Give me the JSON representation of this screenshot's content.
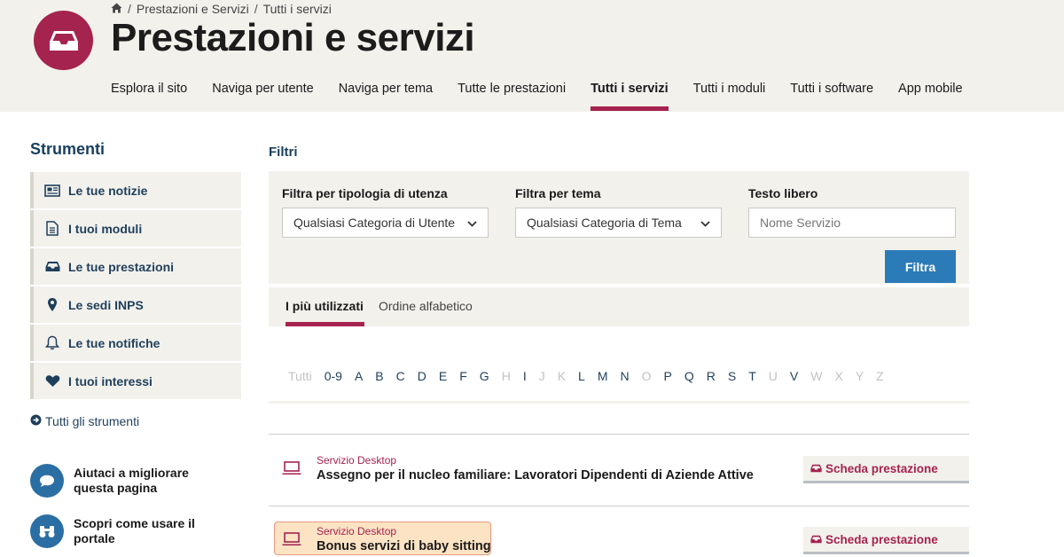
{
  "header": {
    "breadcrumb": [
      "Prestazioni e Servizi",
      "Tutti i servizi"
    ],
    "breadcrumb_sep": "/",
    "title": "Prestazioni e servizi",
    "nav": [
      "Esplora il sito",
      "Naviga per utente",
      "Naviga per tema",
      "Tutte le prestazioni",
      "Tutti i servizi",
      "Tutti i moduli",
      "Tutti i software",
      "App mobile"
    ],
    "nav_active": "Tutti i servizi"
  },
  "sidebar": {
    "title": "Strumenti",
    "items": [
      {
        "label": "Le tue notizie",
        "icon": "newspaper-icon"
      },
      {
        "label": "I tuoi moduli",
        "icon": "document-icon"
      },
      {
        "label": "Le tue prestazioni",
        "icon": "inbox-icon"
      },
      {
        "label": "Le sedi INPS",
        "icon": "map-pin-icon"
      },
      {
        "label": "Le tue notifiche",
        "icon": "bell-icon"
      },
      {
        "label": "I tuoi interessi",
        "icon": "heart-icon"
      }
    ],
    "all_tools": "Tutti gli strumenti",
    "help": [
      {
        "label": "Aiutaci a migliorare questa pagina",
        "icon": "chat-bubble-icon"
      },
      {
        "label": "Scopri come usare il portale",
        "icon": "binoculars-icon"
      }
    ]
  },
  "filters": {
    "heading": "Filtri",
    "user_type_label": "Filtra per tipologia di utenza",
    "user_type_value": "Qualsiasi Categoria di Utente",
    "theme_label": "Filtra per tema",
    "theme_value": "Qualsiasi Categoria di Tema",
    "text_label": "Testo libero",
    "text_placeholder": "Nome Servizio",
    "submit": "Filtra"
  },
  "tabs": {
    "items": [
      "I più utilizzati",
      "Ordine alfabetico"
    ],
    "active": "I più utilizzati"
  },
  "alphabet": {
    "letters": [
      "Tutti",
      "0-9",
      "A",
      "B",
      "C",
      "D",
      "E",
      "F",
      "G",
      "H",
      "I",
      "J",
      "K",
      "L",
      "M",
      "N",
      "O",
      "P",
      "Q",
      "R",
      "S",
      "T",
      "U",
      "V",
      "W",
      "X",
      "Y",
      "Z"
    ],
    "disabled": [
      "Tutti",
      "H",
      "J",
      "K",
      "O",
      "U",
      "W",
      "X",
      "Y",
      "Z"
    ]
  },
  "services": [
    {
      "type": "Servizio Desktop",
      "title": "Assegno per il nucleo familiare: Lavoratori Dipendenti di Aziende Attive",
      "action": "Scheda prestazione"
    },
    {
      "type": "Servizio Desktop",
      "title": "Bonus servizi di baby sitting",
      "action": "Scheda prestazione"
    }
  ],
  "colors": {
    "brand": "#a5234f",
    "primary_button": "#2b7bb9",
    "sidebar_text": "#1f3f5c",
    "panel_bg": "#f2f1ec",
    "highlight_bg": "#fce3c4"
  }
}
